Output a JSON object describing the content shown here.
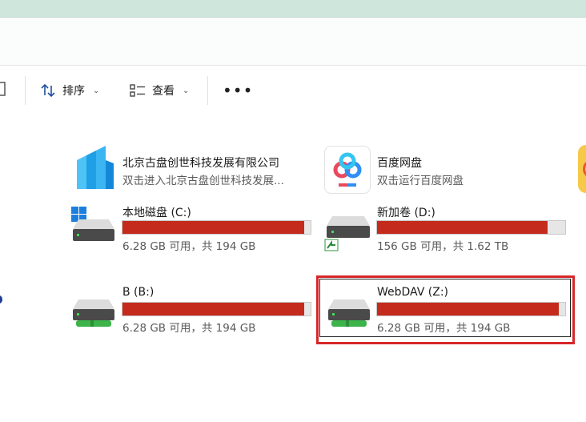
{
  "toolbar": {
    "sort_label": "排序",
    "view_label": "查看",
    "more_label": "•••"
  },
  "apps": [
    {
      "name": "北京古盘创世科技发展有限公司",
      "subtitle": "双击进入北京古盘创世科技发展..."
    },
    {
      "name": "百度网盘",
      "subtitle": "双击运行百度网盘"
    }
  ],
  "drives": [
    {
      "name": "本地磁盘 (C:)",
      "free_text": "6.28 GB 可用，共 194 GB",
      "used_fraction": 0.968
    },
    {
      "name": "新加卷 (D:)",
      "free_text": "156 GB 可用，共 1.62 TB",
      "used_fraction": 0.906
    },
    {
      "name": "B (B:)",
      "free_text": "6.28 GB 可用，共 194 GB",
      "used_fraction": 0.968
    },
    {
      "name": "WebDAV (Z:)",
      "free_text": "6.28 GB 可用，共 194 GB",
      "used_fraction": 0.968,
      "selected": true
    }
  ],
  "colors": {
    "usage_bar": "#c42b1c",
    "highlight": "#d6272a",
    "network_drive": "#3cb44a"
  }
}
